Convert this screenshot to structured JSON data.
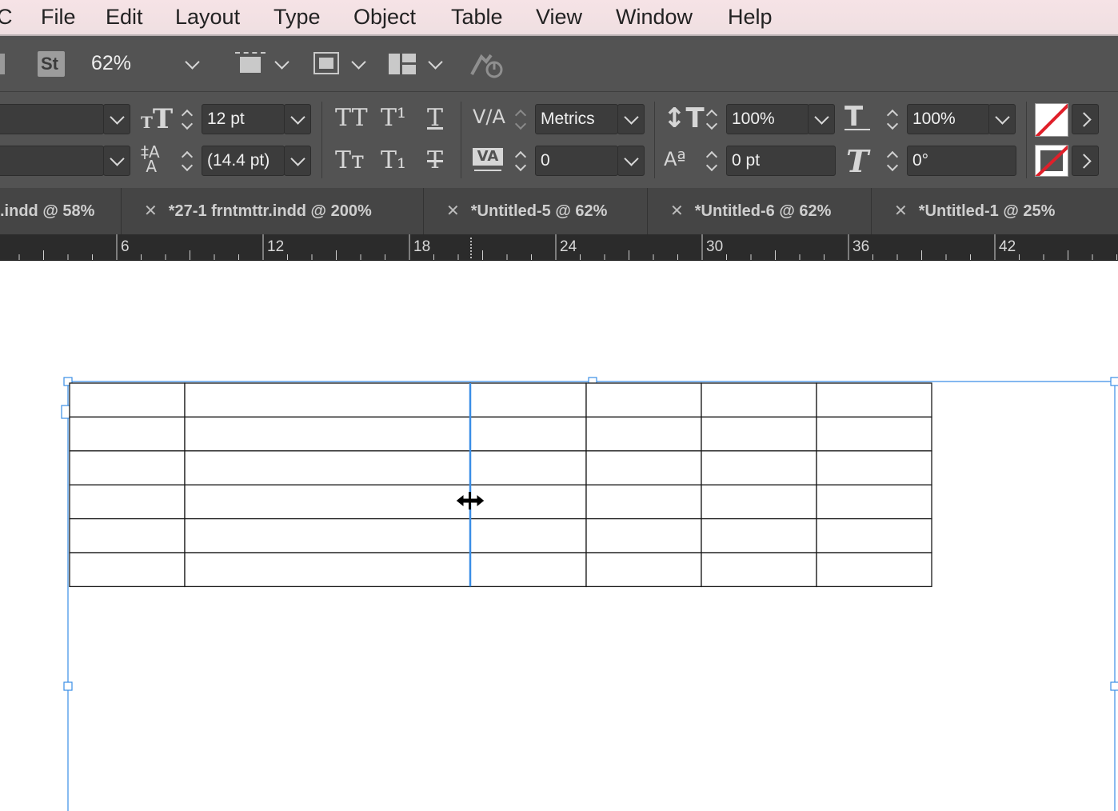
{
  "menubar": {
    "app_fragment": "C",
    "items": [
      "File",
      "Edit",
      "Layout",
      "Type",
      "Object",
      "Table",
      "View",
      "Window",
      "Help"
    ]
  },
  "appbar": {
    "stock_label": "St",
    "zoom": "62%"
  },
  "control_panel": {
    "font_size": "12 pt",
    "leading": "(14.4 pt)",
    "kerning": "Metrics",
    "tracking": "0",
    "vertical_scale": "100%",
    "horizontal_scale": "100%",
    "baseline_shift": "0 pt",
    "skew": "0°",
    "glyphs": {
      "all_caps": "TT",
      "superscript": "T¹",
      "underline": "T",
      "small_caps": "Tт",
      "subscript": "T₁",
      "strikethrough": "T"
    }
  },
  "tabs": [
    {
      "label": ".indd @ 58%",
      "closable": false
    },
    {
      "label": "*27-1 frntmttr.indd @ 200%",
      "closable": true
    },
    {
      "label": "*Untitled-5 @ 62%",
      "closable": true
    },
    {
      "label": "*Untitled-6 @ 62%",
      "closable": true
    },
    {
      "label": "*Untitled-1 @ 25%",
      "closable": true
    }
  ],
  "ruler": {
    "labels": [
      "6",
      "12",
      "18",
      "24",
      "30",
      "36",
      "42"
    ]
  },
  "table": {
    "rows": 6,
    "columns": 6
  },
  "colors": {
    "selection_blue": "#3a8ee6",
    "panel_bg": "#535353",
    "none_swatch_red": "#e0202a"
  }
}
